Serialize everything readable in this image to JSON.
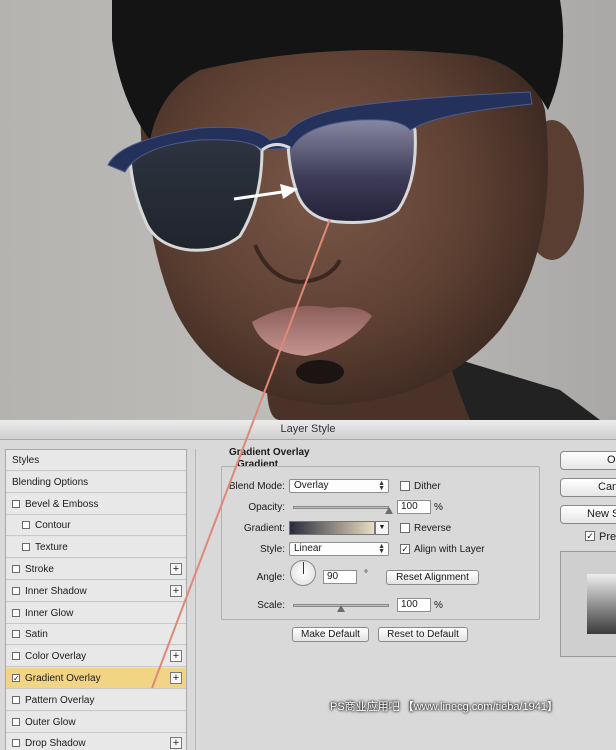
{
  "dialog": {
    "title": "Layer Style"
  },
  "styles_panel": {
    "items": [
      {
        "label": "Styles",
        "checkbox": false,
        "checked": false,
        "plus": false,
        "selected": false
      },
      {
        "label": "Blending Options",
        "checkbox": false,
        "checked": false,
        "plus": false,
        "selected": false
      },
      {
        "label": "Bevel & Emboss",
        "checkbox": true,
        "checked": false,
        "plus": false,
        "selected": false
      },
      {
        "label": "Contour",
        "checkbox": true,
        "checked": false,
        "plus": false,
        "selected": false,
        "indent": true
      },
      {
        "label": "Texture",
        "checkbox": true,
        "checked": false,
        "plus": false,
        "selected": false,
        "indent": true
      },
      {
        "label": "Stroke",
        "checkbox": true,
        "checked": false,
        "plus": true,
        "selected": false
      },
      {
        "label": "Inner Shadow",
        "checkbox": true,
        "checked": false,
        "plus": true,
        "selected": false
      },
      {
        "label": "Inner Glow",
        "checkbox": true,
        "checked": false,
        "plus": false,
        "selected": false
      },
      {
        "label": "Satin",
        "checkbox": true,
        "checked": false,
        "plus": false,
        "selected": false
      },
      {
        "label": "Color Overlay",
        "checkbox": true,
        "checked": false,
        "plus": true,
        "selected": false
      },
      {
        "label": "Gradient Overlay",
        "checkbox": true,
        "checked": true,
        "plus": true,
        "selected": true
      },
      {
        "label": "Pattern Overlay",
        "checkbox": true,
        "checked": false,
        "plus": false,
        "selected": false
      },
      {
        "label": "Outer Glow",
        "checkbox": true,
        "checked": false,
        "plus": false,
        "selected": false
      },
      {
        "label": "Drop Shadow",
        "checkbox": true,
        "checked": false,
        "plus": true,
        "selected": false
      }
    ]
  },
  "gradient_overlay": {
    "section_title": "Gradient Overlay",
    "group_title": "Gradient",
    "blend_mode_label": "Blend Mode:",
    "blend_mode_value": "Overlay",
    "dither_label": "Dither",
    "dither_checked": false,
    "opacity_label": "Opacity:",
    "opacity_value": "100",
    "opacity_unit": "%",
    "opacity_fraction": 1.0,
    "gradient_label": "Gradient:",
    "gradient_colors": [
      "#2a2c3c",
      "#e8dcc0"
    ],
    "reverse_label": "Reverse",
    "reverse_checked": false,
    "style_label": "Style:",
    "style_value": "Linear",
    "align_label": "Align with Layer",
    "align_checked": true,
    "angle_label": "Angle:",
    "angle_value": "90",
    "angle_unit": "°",
    "reset_alignment_label": "Reset Alignment",
    "scale_label": "Scale:",
    "scale_value": "100",
    "scale_unit": "%",
    "scale_fraction": 0.5,
    "make_default_label": "Make Default",
    "reset_default_label": "Reset to Default"
  },
  "right_buttons": {
    "ok_label": "O",
    "cancel_label": "Can",
    "new_style_label": "New S",
    "preview_label": "Pre",
    "preview_checked": true
  },
  "watermark": "PS商业应用吧 【www.linecg.com/tieba/1941】",
  "colors": {
    "selected_row": "#f1d484",
    "annotation_line": "#e08878",
    "arrow": "#ffffff"
  }
}
